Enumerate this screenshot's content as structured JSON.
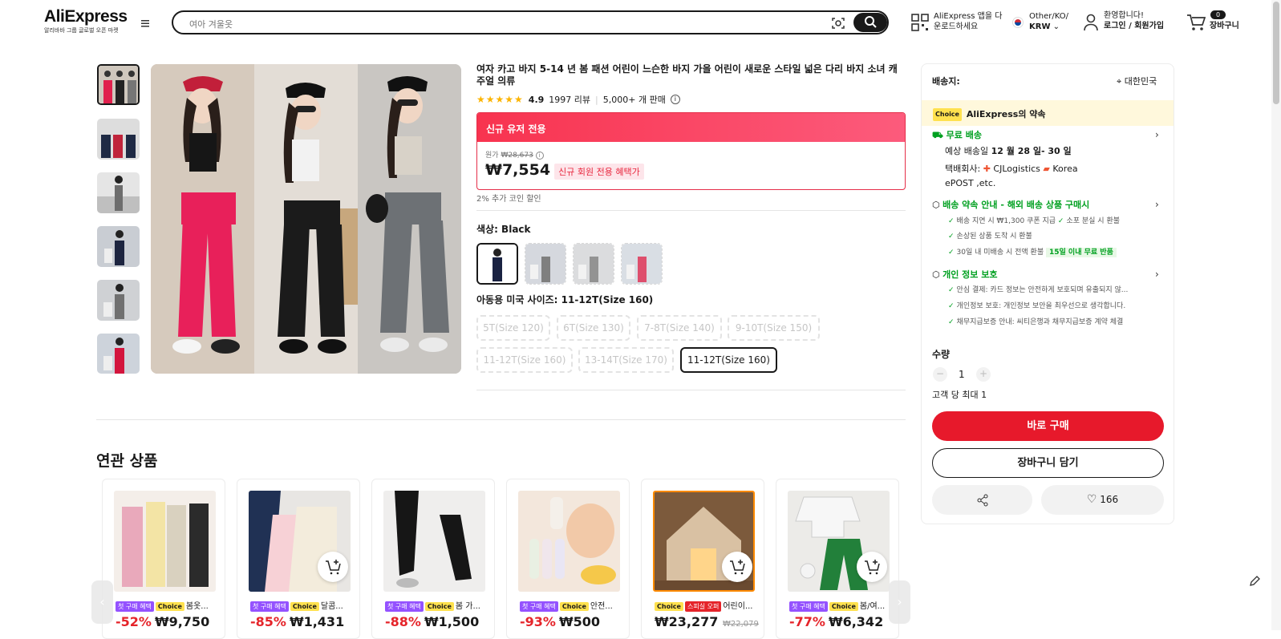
{
  "header": {
    "logo": "AliExpress",
    "logo_sub": "알리바바 그룹 글로벌 오픈 마켓",
    "search_placeholder": "여아 겨울옷",
    "app_promo": [
      "AliExpress 앱을 다",
      "운로드하세요"
    ],
    "region": "Other/KO/",
    "currency": "KRW",
    "welcome": "환영합니다!",
    "login": "로그인 / 회원가입",
    "cart_count": "0",
    "cart_label": "장바구니"
  },
  "product": {
    "title": "여자 카고 바지 5-14 년 봄 패션 어린이 느슨한 바지 가을 어린이 새로운 스타일 넓은 다리 바지 소녀 캐주얼 의류",
    "rating": "4.9",
    "reviews": "1997 리뷰",
    "sold": "5,000+ 개 판매",
    "promo_header": "신규 유저 전용",
    "orig_label": "원가",
    "orig_price": "₩28,673",
    "price": "₩7,554",
    "new_badge": "신규 회원 전용 혜택가",
    "coin_note": "2% 추가 코인 할인",
    "color_label": "색상: Black",
    "size_label": "아동용 미국 사이즈: 11-12T(Size 160)",
    "sizes": [
      "5T(Size 120)",
      "6T(Size 130)",
      "7-8T(Size 140)",
      "9-10T(Size 150)",
      "11-12T(Size 160)",
      "13-14T(Size 170)",
      "11-12T(Size 160)"
    ]
  },
  "related": {
    "title": "연관 상품",
    "items": [
      {
        "tags": [
          "첫 구매 혜택",
          "Choice"
        ],
        "name": "봄옷...",
        "discount": "-52%",
        "price": "₩9,750",
        "orig": ""
      },
      {
        "tags": [
          "첫 구매 혜택",
          "Choice"
        ],
        "name": "달콤...",
        "discount": "-85%",
        "price": "₩1,431",
        "orig": ""
      },
      {
        "tags": [
          "첫 구매 혜택",
          "Choice"
        ],
        "name": "봄 가...",
        "discount": "-88%",
        "price": "₩1,500",
        "orig": ""
      },
      {
        "tags": [
          "첫 구매 혜택",
          "Choice"
        ],
        "name": "안전...",
        "discount": "-93%",
        "price": "₩500",
        "orig": ""
      },
      {
        "tags": [
          "Choice",
          "스피실 오퍼"
        ],
        "name": "어린이...",
        "discount": "",
        "price": "₩23,277",
        "orig": "₩22,079"
      },
      {
        "tags": [
          "첫 구매 혜택",
          "Choice"
        ],
        "name": "봄/여...",
        "discount": "-77%",
        "price": "₩6,342",
        "orig": ""
      }
    ]
  },
  "side": {
    "ship_to_label": "배송지:",
    "country": "대한민국",
    "choice_tag": "Choice",
    "choice_promise": "AliExpress의 약속",
    "free_ship": "무료 배송",
    "eta_prefix": "예상 배송일",
    "eta_date": "12 월 28 일- 30 일",
    "carrier_prefix": "택배회사:",
    "carrier1": "CJLogistics",
    "carrier2": "Korea",
    "carrier3": "ePOST ,etc.",
    "guarantee_title": "배송 약속 안내 - 해외 배송 상품 구매시",
    "g1": "배송 지연 시 ₩1,300 쿠폰 지급",
    "g2": "소포 분실 시 환불",
    "g3": "손상된 상품 도착 시 환불",
    "g4": "30일 내 미배송 시 전액 환불",
    "g4_badge": "15일 이내 무료 반품",
    "privacy_title": "개인 정보 보호",
    "p1": "안심 결제: 카드 정보는 안전하게 보호되며 유출되지 않...",
    "p2": "개인정보 보호: 개인정보 보안을 최우선으로 생각합니다.",
    "p3": "채무지급보증 안내: 씨티은행과 채무지급보증 계약 체결",
    "qty_label": "수량",
    "qty_value": "1",
    "max_note": "고객 당 최대 1",
    "buy_now": "바로 구매",
    "add_cart": "장바구니 담기",
    "wishlist_count": "166"
  },
  "colors": {
    "accent": "#e7192b",
    "green": "#00a020",
    "choice": "#ffe14e"
  }
}
